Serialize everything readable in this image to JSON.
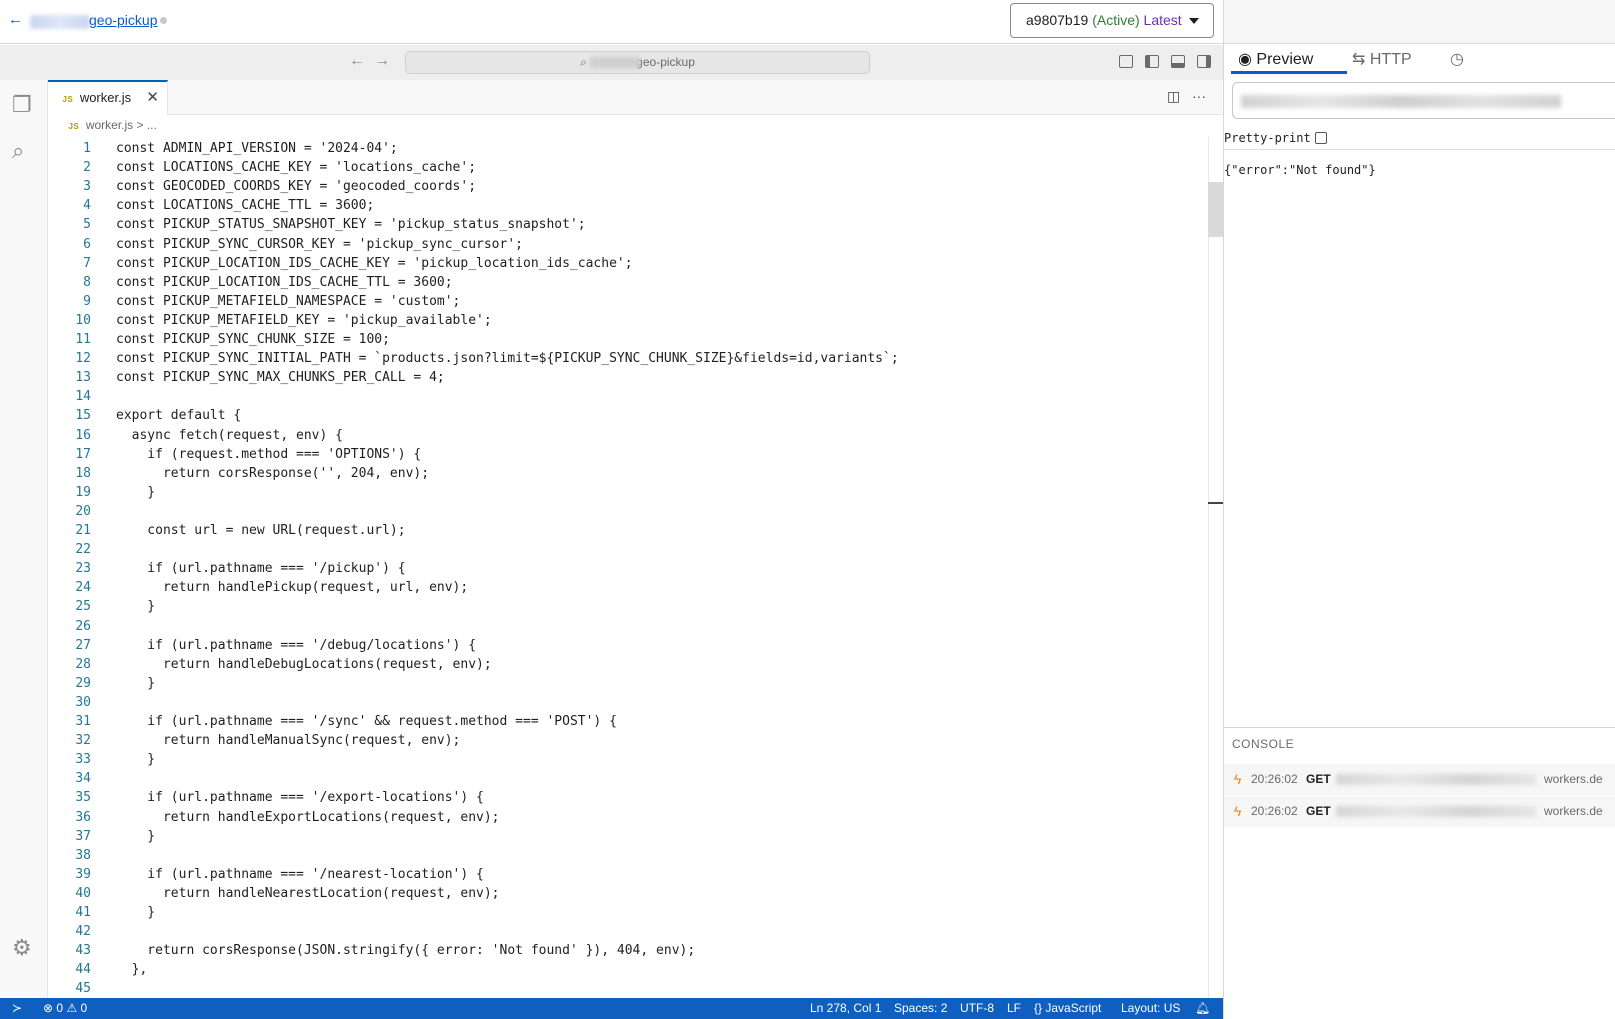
{
  "topbar": {
    "back_icon": "arrow-left-icon",
    "project_name": "geo-pickup",
    "version_hash": "a9807b19",
    "version_active": "(Active)",
    "version_latest": "Latest"
  },
  "titlebar": {
    "search_text": "geo-pickup"
  },
  "editor": {
    "tab_label": "worker.js",
    "tab_badge": "JS",
    "breadcrumb_file": "worker.js",
    "breadcrumb_rest": "> ..."
  },
  "code_lines": [
    {
      "n": "1"
    },
    {
      "n": "2"
    },
    {
      "n": "3"
    },
    {
      "n": "4"
    },
    {
      "n": "5"
    },
    {
      "n": "6"
    },
    {
      "n": "7"
    },
    {
      "n": "8"
    },
    {
      "n": "9"
    },
    {
      "n": "10"
    },
    {
      "n": "11"
    },
    {
      "n": "12"
    },
    {
      "n": "13"
    },
    {
      "n": "14"
    },
    {
      "n": "15"
    },
    {
      "n": "16"
    },
    {
      "n": "17"
    },
    {
      "n": "18"
    },
    {
      "n": "19"
    },
    {
      "n": "20"
    },
    {
      "n": "21"
    },
    {
      "n": "22"
    },
    {
      "n": "23"
    },
    {
      "n": "24"
    },
    {
      "n": "25"
    },
    {
      "n": "26"
    },
    {
      "n": "27"
    },
    {
      "n": "28"
    },
    {
      "n": "29"
    },
    {
      "n": "30"
    },
    {
      "n": "31"
    },
    {
      "n": "32"
    },
    {
      "n": "33"
    },
    {
      "n": "34"
    },
    {
      "n": "35"
    },
    {
      "n": "36"
    },
    {
      "n": "37"
    },
    {
      "n": "38"
    },
    {
      "n": "39"
    },
    {
      "n": "40"
    },
    {
      "n": "41"
    },
    {
      "n": "42"
    },
    {
      "n": "43"
    },
    {
      "n": "44"
    },
    {
      "n": "45"
    }
  ],
  "code_text": [
    "const ADMIN_API_VERSION = '2024-04';",
    "const LOCATIONS_CACHE_KEY = 'locations_cache';",
    "const GEOCODED_COORDS_KEY = 'geocoded_coords';",
    "const LOCATIONS_CACHE_TTL = 3600;",
    "const PICKUP_STATUS_SNAPSHOT_KEY = 'pickup_status_snapshot';",
    "const PICKUP_SYNC_CURSOR_KEY = 'pickup_sync_cursor';",
    "const PICKUP_LOCATION_IDS_CACHE_KEY = 'pickup_location_ids_cache';",
    "const PICKUP_LOCATION_IDS_CACHE_TTL = 3600;",
    "const PICKUP_METAFIELD_NAMESPACE = 'custom';",
    "const PICKUP_METAFIELD_KEY = 'pickup_available';",
    "const PICKUP_SYNC_CHUNK_SIZE = 100;",
    "const PICKUP_SYNC_INITIAL_PATH = `products.json?limit=${PICKUP_SYNC_CHUNK_SIZE}&fields=id,variants`;",
    "const PICKUP_SYNC_MAX_CHUNKS_PER_CALL = 4;",
    "",
    "export default {",
    "  async fetch(request, env) {",
    "    if (request.method === 'OPTIONS') {",
    "      return corsResponse('', 204, env);",
    "    }",
    "",
    "    const url = new URL(request.url);",
    "",
    "    if (url.pathname === '/pickup') {",
    "      return handlePickup(request, url, env);",
    "    }",
    "",
    "    if (url.pathname === '/debug/locations') {",
    "      return handleDebugLocations(request, env);",
    "    }",
    "",
    "    if (url.pathname === '/sync' && request.method === 'POST') {",
    "      return handleManualSync(request, env);",
    "    }",
    "",
    "    if (url.pathname === '/export-locations') {",
    "      return handleExportLocations(request, env);",
    "    }",
    "",
    "    if (url.pathname === '/nearest-location') {",
    "      return handleNearestLocation(request, env);",
    "    }",
    "",
    "    return corsResponse(JSON.stringify({ error: 'Not found' }), 404, env);",
    "  },",
    ""
  ],
  "statusbar": {
    "errors": "0",
    "warnings": "0",
    "position": "Ln 278, Col 1",
    "spaces": "Spaces: 2",
    "encoding": "UTF-8",
    "eol": "LF",
    "language": "JavaScript",
    "layout": "Layout: US"
  },
  "preview": {
    "tab_preview": "Preview",
    "tab_http": "HTTP",
    "pretty_print_label": "Pretty-print",
    "response_body": "{\"error\":\"Not found\"}"
  },
  "console": {
    "header": "CONSOLE",
    "entries": [
      {
        "time": "20:26:02",
        "method": "GET",
        "url_tail": "workers.de"
      },
      {
        "time": "20:26:02",
        "method": "GET",
        "url_tail": "workers.de"
      }
    ]
  },
  "colors": {
    "accent": "#0b5ad1",
    "statusbar": "#0e5fbf",
    "active_green": "#2e7d32",
    "latest_purple": "#6b2fb5",
    "console_bolt": "#f38020"
  }
}
